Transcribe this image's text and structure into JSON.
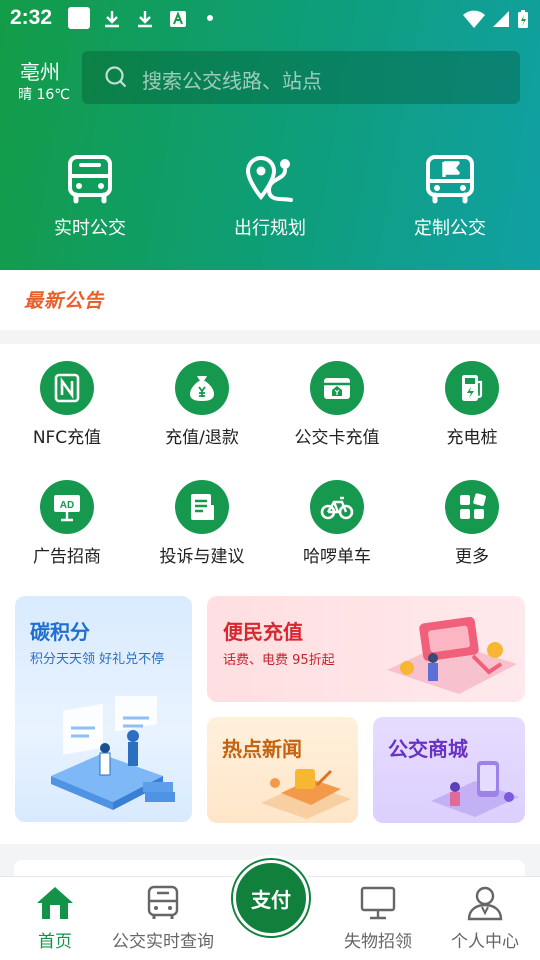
{
  "status_bar": {
    "time": "2:32"
  },
  "header": {
    "city": "亳州",
    "weather": "晴 16℃",
    "search_placeholder": "搜索公交线路、站点",
    "quick_actions": [
      {
        "label": "实时公交",
        "icon": "bus-icon"
      },
      {
        "label": "出行规划",
        "icon": "route-pin-icon"
      },
      {
        "label": "定制公交",
        "icon": "custom-bus-flag-icon"
      }
    ]
  },
  "notice": {
    "title": "最新公告"
  },
  "services": [
    {
      "label": "NFC充值",
      "icon": "nfc-icon"
    },
    {
      "label": "充值/退款",
      "icon": "money-bag-icon"
    },
    {
      "label": "公交卡充值",
      "icon": "card-topup-icon"
    },
    {
      "label": "充电桩",
      "icon": "charging-pile-icon"
    },
    {
      "label": "广告招商",
      "icon": "ad-board-icon"
    },
    {
      "label": "投诉与建议",
      "icon": "feedback-doc-icon"
    },
    {
      "label": "哈啰单车",
      "icon": "bicycle-icon"
    },
    {
      "label": "更多",
      "icon": "more-grid-icon"
    }
  ],
  "promo_cards": {
    "carbon": {
      "title": "碳积分",
      "subtitle": "积分天天领 好礼兑不停"
    },
    "recharge": {
      "title": "便民充值",
      "subtitle": "话费、电费 95折起"
    },
    "news": {
      "title": "热点新闻"
    },
    "mall": {
      "title": "公交商城"
    }
  },
  "tabbar": {
    "tabs": [
      {
        "label": "首页",
        "icon": "home-icon",
        "active": true
      },
      {
        "label": "公交实时查询",
        "icon": "bus-outline-icon"
      },
      {
        "label": "失物招领",
        "icon": "monitor-icon"
      },
      {
        "label": "个人中心",
        "icon": "user-icon"
      }
    ],
    "pay_label": "支付"
  },
  "colors": {
    "primary": "#139c47",
    "notice": "#e8602c",
    "carbon": "#1f6fd1",
    "recharge": "#d9262f",
    "news": "#c4620d",
    "mall": "#6a32c4"
  }
}
